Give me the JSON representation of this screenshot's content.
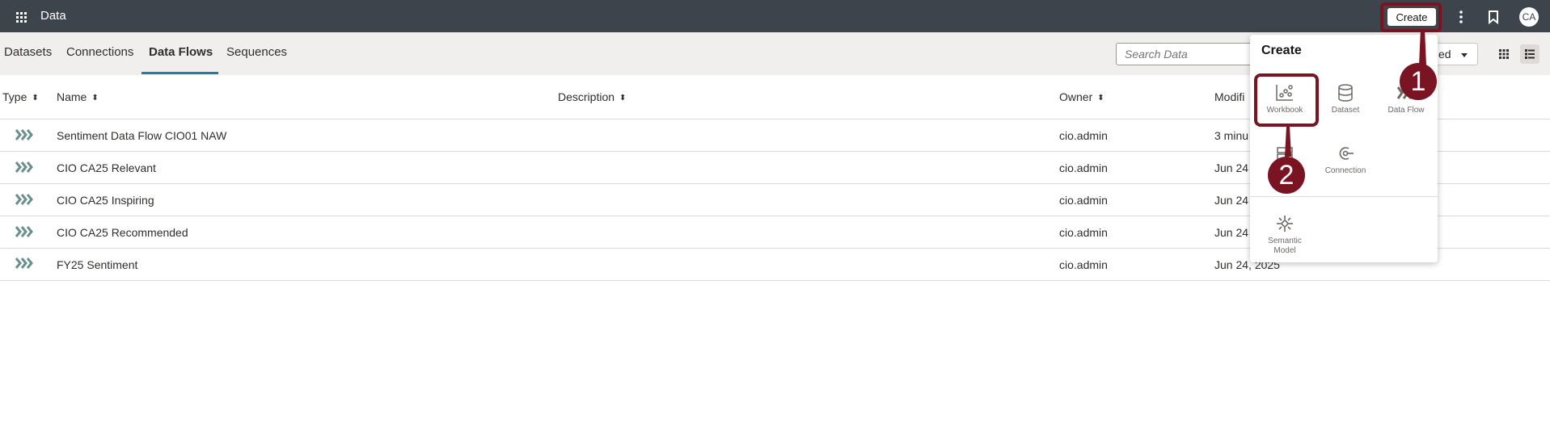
{
  "topbar": {
    "app_title": "Data",
    "create_label": "Create",
    "avatar_initials": "CA",
    "bg_color": "#3e444c"
  },
  "tabs": [
    {
      "label": "Datasets",
      "active": false
    },
    {
      "label": "Connections",
      "active": false
    },
    {
      "label": "Data Flows",
      "active": true
    },
    {
      "label": "Sequences",
      "active": false
    }
  ],
  "toolbar": {
    "search_placeholder": "Search Data",
    "sort_value": "ed"
  },
  "table": {
    "headers": {
      "type": "Type",
      "name": "Name",
      "description": "Description",
      "owner": "Owner",
      "modified": "Modifi"
    },
    "rows": [
      {
        "name": "Sentiment Data Flow CIO01 NAW",
        "description": "",
        "owner": "cio.admin",
        "modified": "3 minu"
      },
      {
        "name": "CIO CA25 Relevant",
        "description": "",
        "owner": "cio.admin",
        "modified": "Jun 24"
      },
      {
        "name": "CIO CA25 Inspiring",
        "description": "",
        "owner": "cio.admin",
        "modified": "Jun 24"
      },
      {
        "name": "CIO CA25 Recommended",
        "description": "",
        "owner": "cio.admin",
        "modified": "Jun 24"
      },
      {
        "name": "FY25 Sentiment",
        "description": "",
        "owner": "cio.admin",
        "modified": "Jun 24, 2025"
      }
    ]
  },
  "create_menu": {
    "title": "Create",
    "items": [
      {
        "label": "Workbook",
        "icon": "workbook-icon"
      },
      {
        "label": "Dataset",
        "icon": "dataset-icon"
      },
      {
        "label": "Data Flow",
        "icon": "data-flow-icon"
      },
      {
        "label": "",
        "icon": "sequence-icon"
      },
      {
        "label": "Connection",
        "icon": "connection-icon"
      },
      {
        "label": "Semantic Model",
        "icon": "semantic-model-icon"
      }
    ]
  },
  "callouts": {
    "step1": "1",
    "step2": "2",
    "color": "#7a1422"
  }
}
